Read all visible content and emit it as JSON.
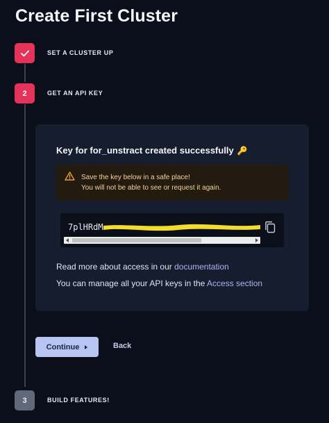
{
  "page": {
    "title": "Create First Cluster"
  },
  "steps": [
    {
      "number": "",
      "label": "SET A CLUSTER UP",
      "status": "completed",
      "icon": "checkmark-icon"
    },
    {
      "number": "2",
      "label": "GET AN API KEY",
      "status": "active"
    },
    {
      "number": "3",
      "label": "BUILD FEATURES!",
      "status": "pending"
    }
  ],
  "card": {
    "title": "Key for for_unstract created successfully",
    "title_emoji": "🔑",
    "warning": {
      "icon": "warning-triangle-icon",
      "line1": "Save the key below in a safe place!",
      "line2": "You will not be able to see or request it again."
    },
    "api_key": {
      "visible_prefix": "7plHRdM",
      "redacted": true,
      "redaction_color": "#f2de2a",
      "copy_icon": "copy-icon"
    },
    "info1": {
      "text": "Read more about access in our ",
      "link": "documentation"
    },
    "info2": {
      "text": "You can manage all your API keys in the ",
      "link": "Access section"
    }
  },
  "actions": {
    "continue_label": "Continue",
    "back_label": "Back"
  },
  "colors": {
    "background": "#0b0f1a",
    "card": "#161d2f",
    "step_active": "#e5325a",
    "step_pending": "#60697a",
    "primary_button": "#b8c4f2",
    "link": "#a9b6f1",
    "warning_bg": "#231b10",
    "warning_text": "#f5d39a"
  }
}
